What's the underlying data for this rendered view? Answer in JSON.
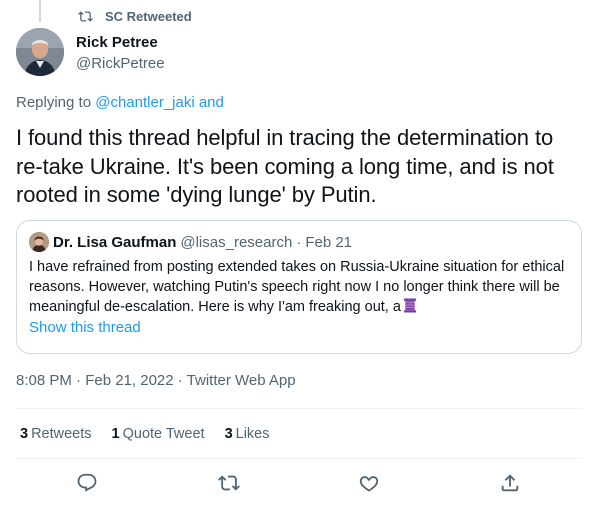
{
  "retweet": {
    "label": "SC Retweeted"
  },
  "author": {
    "display_name": "Rick Petree",
    "handle": "@RickPetree"
  },
  "replying": {
    "prefix": "Replying to ",
    "mentions": "@chantler_jaki and"
  },
  "tweet": {
    "text": "I found this thread helpful in tracing the determination to re-take Ukraine. It's been coming a long time, and is not rooted in some 'dying lunge' by Putin."
  },
  "quote": {
    "display_name": "Dr. Lisa Gaufman",
    "handle": "@lisas_research",
    "separator": "·",
    "date": "Feb 21",
    "text": "I have refrained from posting extended takes on Russia-Ukraine situation for ethical reasons. However, watching Putin's speech right now I no longer think there will be meaningful de-escalation. Here is why I'am freaking out, a",
    "emoji": "thread-spool-emoji",
    "show_thread": "Show this thread"
  },
  "meta": {
    "timestamp": "8:08 PM · Feb 21, 2022 · Twitter Web App"
  },
  "stats": {
    "retweets_count": "3",
    "retweets_label": "Retweets",
    "quotes_count": "1",
    "quotes_label": "Quote Tweet",
    "likes_count": "3",
    "likes_label": "Likes"
  },
  "actions": {
    "reply_icon": "reply-icon",
    "retweet_icon": "retweet-icon",
    "like_icon": "heart-icon",
    "share_icon": "share-icon"
  },
  "colors": {
    "accent": "#1d9bf0",
    "secondary_text": "#536471",
    "border": "#cfd9de"
  }
}
